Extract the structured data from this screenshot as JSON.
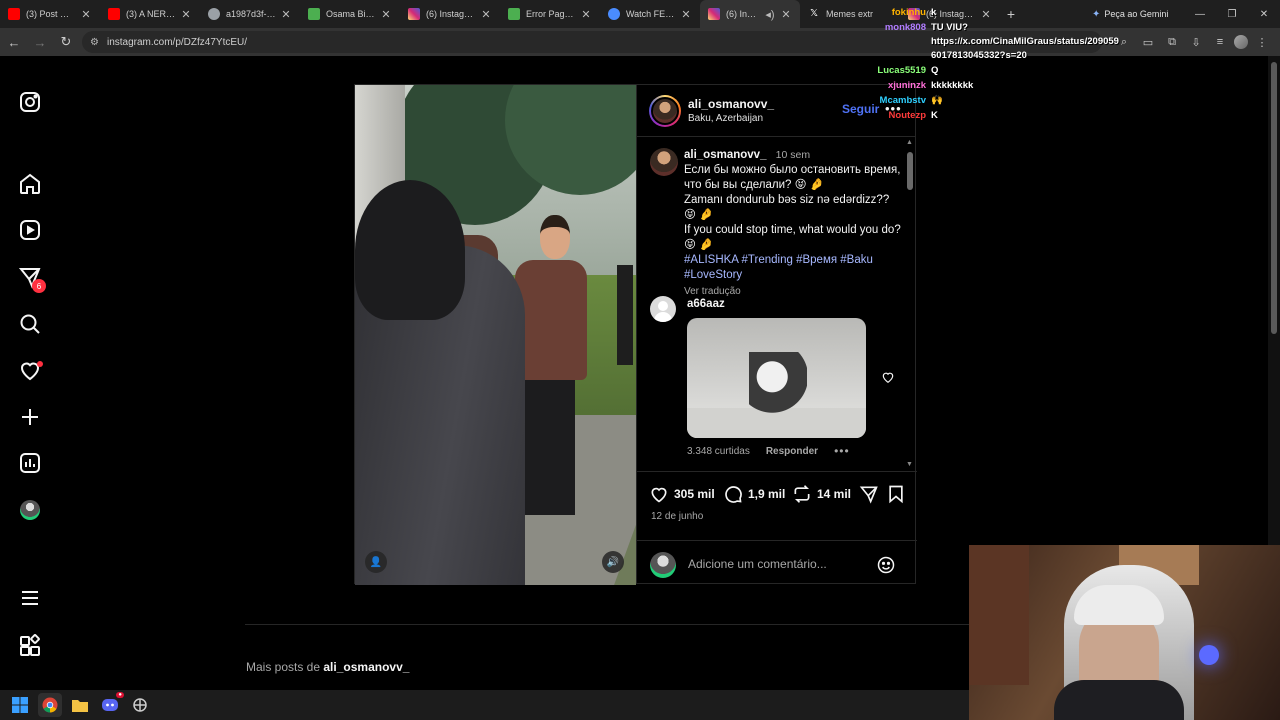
{
  "browser": {
    "tabs": [
      {
        "label": "(3) Post Malone",
        "icon": "youtube-icon",
        "color": "#ff0000"
      },
      {
        "label": "(3) A NERDOLA",
        "icon": "youtube-icon",
        "color": "#ff0000"
      },
      {
        "label": "a1987d3f-1b3b",
        "icon": "globe-icon",
        "color": "#9aa0a6"
      },
      {
        "label": "Osama Bin Lad",
        "icon": "page-icon",
        "color": "#4caf50"
      },
      {
        "label": "(6) Instagram",
        "icon": "instagram-icon",
        "color": "#d62976"
      },
      {
        "label": "Error Page | e",
        "icon": "page-icon",
        "color": "#4caf50"
      },
      {
        "label": "Watch FEAT. T",
        "icon": "watch-icon",
        "color": "#4a8cff"
      },
      {
        "label": "(6) Instagr",
        "icon": "instagram-icon",
        "color": "#d62976",
        "active": true
      },
      {
        "label": "Memes extr",
        "icon": "x-icon",
        "color": "#ffffff"
      },
      {
        "label": "(6) Instagram",
        "icon": "instagram-icon",
        "color": "#d62976"
      }
    ],
    "new_tab": "+",
    "gemini_label": "Peça ao Gemini",
    "url": "instagram.com/p/DZfz47YtcEU/"
  },
  "post": {
    "username": "ali_osmanovv_",
    "location": "Baku, Azerbaijan",
    "follow_label": "Seguir",
    "caption": {
      "username": "ali_osmanovv_",
      "time": "10 sem",
      "line_ru": "Если бы можно было остановить время, что бы вы сделали? 😝 🤌",
      "line_az": "Zamanı dondurub bəs siz nə edərdizz?? 😝 🤌",
      "line_en": "If you could stop time, what would you do? 😝 🤌",
      "hashtags": "#ALISHKA #Trending #Время #Baku #LoveStory",
      "translate": "Ver tradução"
    },
    "comment": {
      "username": "a66aaz",
      "likes": "3.348 curtidas",
      "reply": "Responder",
      "more": "•••"
    },
    "likes": "305 mil",
    "comments_count": "1,9 mil",
    "reposts": "14 mil",
    "date": "12 de junho",
    "add_comment_placeholder": "Adicione um comentário..."
  },
  "more_posts": {
    "prefix": "Mais posts de ",
    "username": "ali_osmanovv_"
  },
  "chat": [
    {
      "name": "fokinhu",
      "message": "k",
      "color": "#ffb400"
    },
    {
      "name": "monk808",
      "message": "TU VIU?",
      "color": "#b07cff"
    },
    {
      "name": "",
      "message": "https://x.com/CinaMilGraus/status/209059",
      "color": "#ffffff"
    },
    {
      "name": "",
      "message": "6017813045332?s=20",
      "color": "#ffffff"
    },
    {
      "name": "Lucas5519",
      "message": "Q",
      "color": "#8bff7a"
    },
    {
      "name": "xjuninzk",
      "message": "kkkkkkkk",
      "color": "#ff6fd8"
    },
    {
      "name": "Mcambstv",
      "message": "🙌",
      "color": "#2fd0ff"
    },
    {
      "name": "Noutezp",
      "message": "K",
      "color": "#ff3b3b"
    }
  ],
  "icons": {
    "sidebar": [
      "instagram-icon",
      "home-icon",
      "reels-icon",
      "messages-icon",
      "search-icon",
      "notifications-icon",
      "create-icon",
      "dashboard-icon",
      "profile-icon",
      "menu-icon",
      "apps-icon"
    ]
  },
  "messages_badge": "6",
  "colors": {
    "accent": "#4f72f5",
    "badge": "#ff3040",
    "hashtag": "#a7b8ff"
  }
}
